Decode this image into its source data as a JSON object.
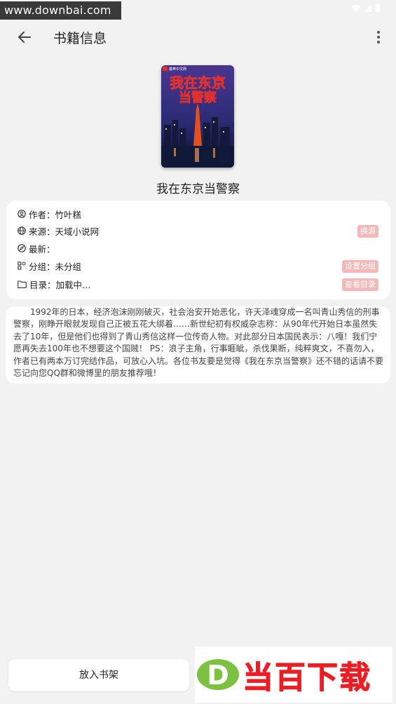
{
  "watermark_top": "www.downbai.com",
  "appbar": {
    "title": "书籍信息"
  },
  "book": {
    "cover_publisher": "塞奔中文网",
    "cover_title_line1": "我在东京",
    "cover_title_line2": "当警察",
    "title": "我在东京当警察"
  },
  "info": {
    "author_label": "作者：",
    "author": "竹叶糕",
    "source_label": "来源：",
    "source": "天域小说网",
    "source_action": "换源",
    "latest_label": "最新：",
    "latest": "",
    "group_label": "分组：",
    "group": "未分组",
    "group_action": "设置分组",
    "toc_label": "目录：",
    "toc": "加载中…",
    "toc_action": "查看目录"
  },
  "intro": "1992年的日本，经济泡沫刚刚破灭，社会治安开始恶化，许天泽魂穿成一名叫青山秀信的刑事警察，刚睁开眼就发现自己正被五花大绑着……新世纪初有权威杂志称：从90年代开始日本虽然失去了10年，但是他们也得到了青山秀信这样一位传奇人物。对此部分日本国民表示：八嘎！我们宁愿再失去100年也不想要这个国贼！ PS：浪子主角，行事睚眦，杀伐果断，纯粹爽文，不喜勿入，作者已有两本万订完结作品，可放心入坑。各位书友要是觉得《我在东京当警察》还不错的话请不要忘记向您QQ群和微博里的朋友推荐哦！",
  "bottom": {
    "shelf_button": "放入书架",
    "watermark_brand": "当百下载"
  },
  "colors": {
    "accent_pill": "#f5b8b8",
    "brand_red": "#ec1d24",
    "brand_green": "#7cc142"
  }
}
